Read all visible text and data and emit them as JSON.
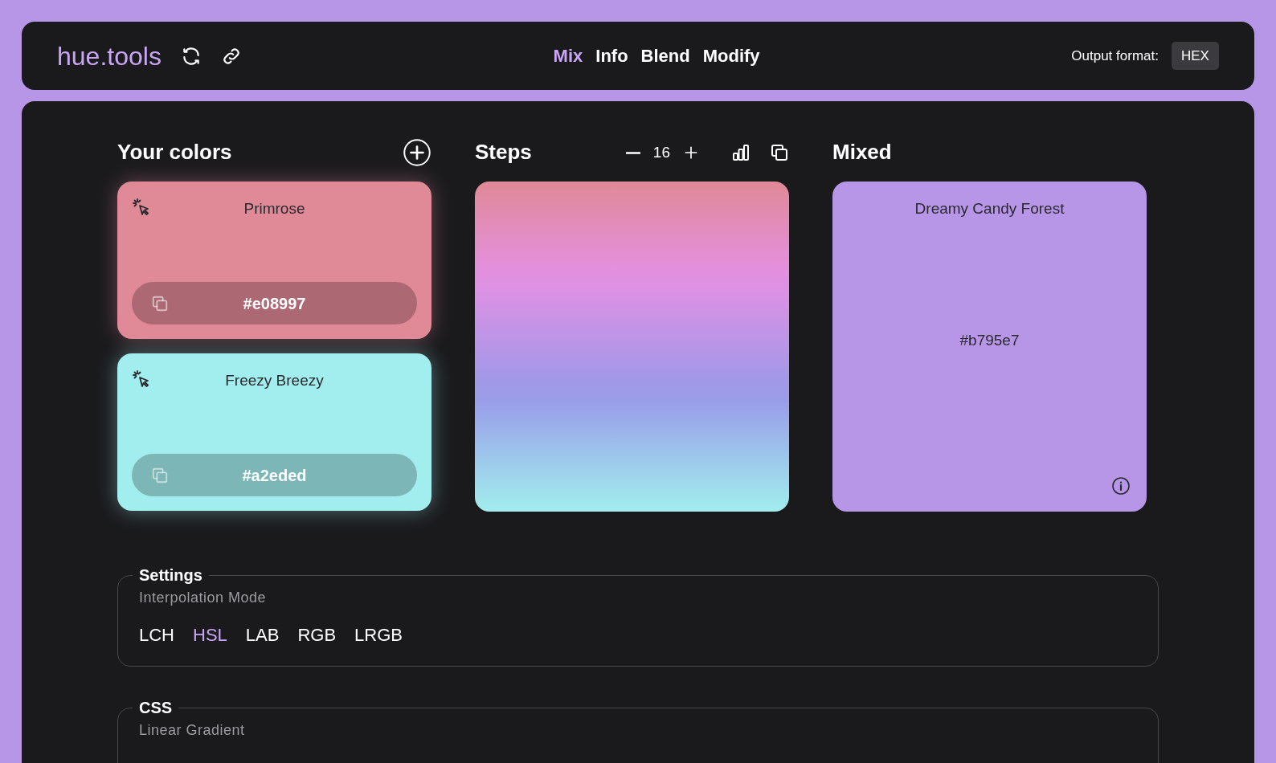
{
  "header": {
    "logo": "hue.tools",
    "nav": [
      {
        "label": "Mix",
        "selected": true
      },
      {
        "label": "Info",
        "selected": false
      },
      {
        "label": "Blend",
        "selected": false
      },
      {
        "label": "Modify",
        "selected": false
      }
    ],
    "output_format": {
      "label": "Output format:",
      "value": "HEX"
    }
  },
  "your_colors": {
    "title": "Your colors",
    "colors": [
      {
        "name": "Primrose",
        "hex": "#e08997",
        "color": "#e08997"
      },
      {
        "name": "Freezy Breezy",
        "hex": "#a2eded",
        "color": "#a2eded"
      }
    ]
  },
  "steps": {
    "title": "Steps",
    "count": "16"
  },
  "mixed": {
    "title": "Mixed",
    "name": "Dreamy Candy Forest",
    "hex": "#b795e7",
    "color": "#b795e7"
  },
  "settings": {
    "legend": "Settings",
    "label": "Interpolation Mode",
    "modes": [
      {
        "label": "LCH",
        "selected": false
      },
      {
        "label": "HSL",
        "selected": true
      },
      {
        "label": "LAB",
        "selected": false
      },
      {
        "label": "RGB",
        "selected": false
      },
      {
        "label": "LRGB",
        "selected": false
      }
    ]
  },
  "css": {
    "legend": "CSS",
    "label": "Linear Gradient"
  }
}
